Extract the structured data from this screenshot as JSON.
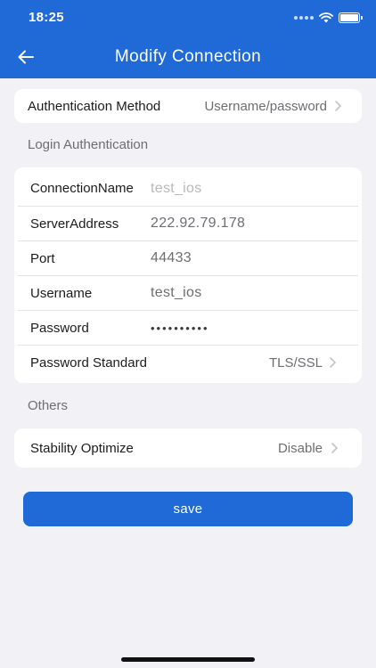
{
  "status_bar": {
    "time": "18:25"
  },
  "header": {
    "title": "Modify Connection",
    "back_icon": "arrow-left-icon"
  },
  "auth_method": {
    "label": "Authentication Method",
    "value": "Username/password"
  },
  "login_section": {
    "title": "Login Authentication",
    "rows": [
      {
        "label": "ConnectionName",
        "value": "test_ios"
      },
      {
        "label": "ServerAddress",
        "value": "222.92.79.178"
      },
      {
        "label": "Port",
        "value": "44433"
      },
      {
        "label": "Username",
        "value": "test_ios"
      },
      {
        "label": "Password",
        "value": "••••••••••"
      }
    ],
    "password_standard": {
      "label": "Password Standard",
      "value": "TLS/SSL"
    }
  },
  "others_section": {
    "title": "Others",
    "stability": {
      "label": "Stability Optimize",
      "value": "Disable"
    }
  },
  "save_label": "save",
  "colors": {
    "brand": "#1f6ad6",
    "background": "#f2f2f6"
  }
}
